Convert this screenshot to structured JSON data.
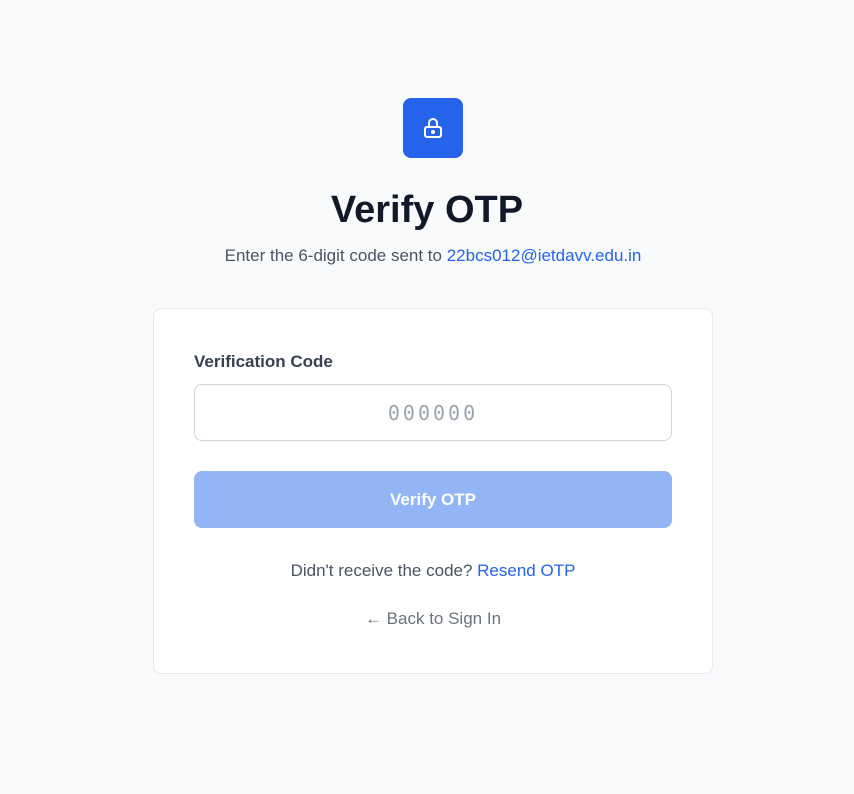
{
  "header": {
    "icon": "lock-icon",
    "accent_color": "#2563eb",
    "title": "Verify OTP",
    "subtitle_prefix": "Enter the 6-digit code sent to ",
    "email": "22bcs012@ietdavv.edu.in"
  },
  "form": {
    "code_label": "Verification Code",
    "code_value": "",
    "code_placeholder": "000000",
    "verify_label": "Verify OTP",
    "verify_button_color": "#93b4f5",
    "resend_prompt": "Didn't receive the code? ",
    "resend_label": "Resend OTP",
    "back_label": "← Back to Sign In"
  }
}
